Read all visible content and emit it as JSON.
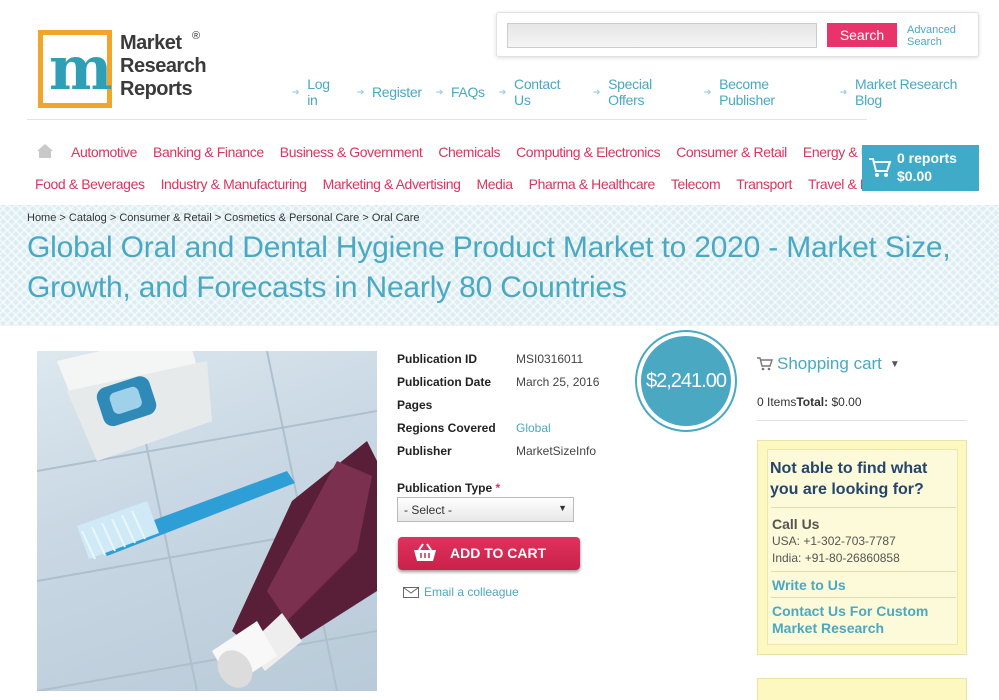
{
  "logo": {
    "line1": "Market",
    "line2": "Research",
    "line3": "Reports",
    "mark": "m",
    "registered": "®"
  },
  "search": {
    "placeholder": "",
    "button": "Search",
    "advanced": "Advanced Search"
  },
  "top_links": [
    "Log in",
    "Register",
    "FAQs",
    "Contact Us",
    "Special Offers",
    "Become Publisher",
    "Market Research Blog"
  ],
  "categories_row1": [
    "Automotive",
    "Banking & Finance",
    "Business & Government",
    "Chemicals",
    "Computing & Electronics",
    "Consumer & Retail",
    "Energy & Utilities"
  ],
  "categories_row2": [
    "Food & Beverages",
    "Industry & Manufacturing",
    "Marketing & Advertising",
    "Media",
    "Pharma & Healthcare",
    "Telecom",
    "Transport",
    "Travel & Leisure"
  ],
  "cart": {
    "reports": "0 reports",
    "total": "$0.00"
  },
  "breadcrumb": "Home > Catalog > Consumer & Retail > Cosmetics & Personal Care > Oral Care",
  "title": "Global Oral and Dental Hygiene Product Market to 2020 - Market Size, Growth, and Forecasts in Nearly 80 Countries",
  "details": [
    {
      "label": "Publication ID",
      "value": "MSI0316011"
    },
    {
      "label": "Publication Date",
      "value": "March 25, 2016"
    },
    {
      "label": "Pages",
      "value": ""
    },
    {
      "label": "Regions Covered",
      "value": "Global"
    },
    {
      "label": "Publisher",
      "value": "MarketSizeInfo"
    }
  ],
  "publication_type": {
    "label": "Publication Type",
    "required": "*",
    "selected": "- Select -"
  },
  "add_to_cart": "ADD TO CART",
  "email_colleague": "Email a colleague",
  "price": "$2,241.00",
  "shopping_cart": {
    "title": "Shopping cart",
    "items": "0 Items",
    "total_label": "Total:",
    "total": "$0.00"
  },
  "help": {
    "title": "Not able to find what you are looking for?",
    "call_us": "Call Us",
    "usa": "USA: +1-302-703-7787",
    "india": "India: +91-80-26860858",
    "write_us": "Write to Us",
    "custom": "Contact Us For Custom Market Research"
  },
  "colors": {
    "accent": "#4aa8c3",
    "category": "#d9355f",
    "button": "#e8336b",
    "logo_orange": "#f2a52b"
  }
}
